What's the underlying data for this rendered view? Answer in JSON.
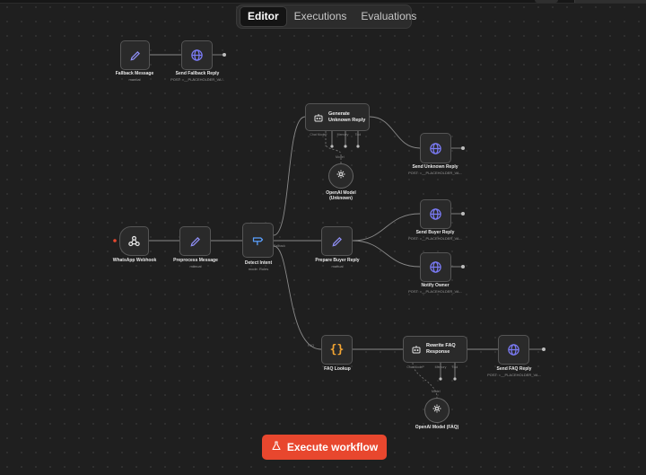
{
  "tabs": [
    {
      "label": "Editor",
      "active": true
    },
    {
      "label": "Executions",
      "active": false
    },
    {
      "label": "Evaluations",
      "active": false
    }
  ],
  "nodes": {
    "fallback_message": {
      "label": "Fallback Message",
      "sub": "manual"
    },
    "send_fallback_reply": {
      "label": "Send Fallback Reply",
      "sub": "POST: =__PLACEHOLDER_VA..."
    },
    "generate_unknown_reply": {
      "label": "Generate\nUnknown Reply",
      "ports": [
        "Chat Model*",
        "Memory",
        "Tool"
      ]
    },
    "openai_unknown": {
      "label": "OpenAI Model\n(Unknown)"
    },
    "send_unknown_reply": {
      "label": "Send Unknown Reply",
      "sub": "POST: =__PLACEHOLDER_VA..."
    },
    "whatsapp_webhook": {
      "label": "WhatsApp Webhook"
    },
    "preprocess_message": {
      "label": "Preprocess Message",
      "sub": "manual"
    },
    "detect_intent": {
      "label": "Detect Intent",
      "sub": "mode: Rules"
    },
    "prepare_buyer_reply": {
      "label": "Prepare Buyer Reply",
      "sub": "manual"
    },
    "send_buyer_reply": {
      "label": "Send Buyer Reply",
      "sub": "POST: =__PLACEHOLDER_VA..."
    },
    "notify_owner": {
      "label": "Notify Owner",
      "sub": "POST: =__PLACEHOLDER_VA..."
    },
    "faq_lookup": {
      "label": "FAQ Lookup"
    },
    "rewrite_faq_response": {
      "label": "Rewrite FAQ\nResponse",
      "ports": [
        "Chat Model*",
        "Memory",
        "Tool"
      ]
    },
    "send_faq_reply": {
      "label": "Send FAQ Reply",
      "sub": "POST: =__PLACEHOLDER_VA..."
    },
    "openai_faq": {
      "label": "OpenAI Model (FAQ)"
    }
  },
  "edge_labels": {
    "model": "Model",
    "fallback": "Fallback",
    "faq_route": "FAQ"
  },
  "execute_button": {
    "label": "Execute workflow"
  },
  "colors": {
    "accent": "#e8472e",
    "globe": "#7b7bf5",
    "pencil": "#8f8ff5",
    "braces": "#f3a532",
    "canvas": "#1f1f1f"
  }
}
